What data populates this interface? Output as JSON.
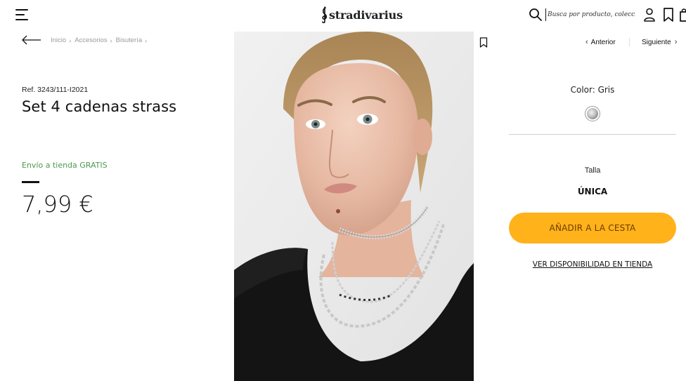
{
  "header": {
    "brand": "stradivarius",
    "search_placeholder": "Busca por producto, colección..."
  },
  "breadcrumb": {
    "items": [
      "Inicio",
      "Accesorios",
      "Bisutería"
    ]
  },
  "product": {
    "ref": "Ref. 3243/111-I2021",
    "title": "Set 4 cadenas strass",
    "shipping": "Envío a tienda GRATIS",
    "price": "7,99 €",
    "image_icon": "product-photo-model-wearing-necklaces"
  },
  "navigation": {
    "prev_label": "Anterior",
    "next_label": "Siguiente"
  },
  "options": {
    "color_label": "Color: Gris",
    "size_label": "Talla",
    "size_value": "ÚNICA"
  },
  "actions": {
    "add_to_cart": "AÑADIR A LA CESTA",
    "availability": "VER DISPONIBILIDAD EN TIENDA"
  },
  "colors": {
    "accent": "#ffb21a",
    "shipping_green": "#4b9a4b",
    "breadcrumb_grey": "#9a9a9a"
  }
}
